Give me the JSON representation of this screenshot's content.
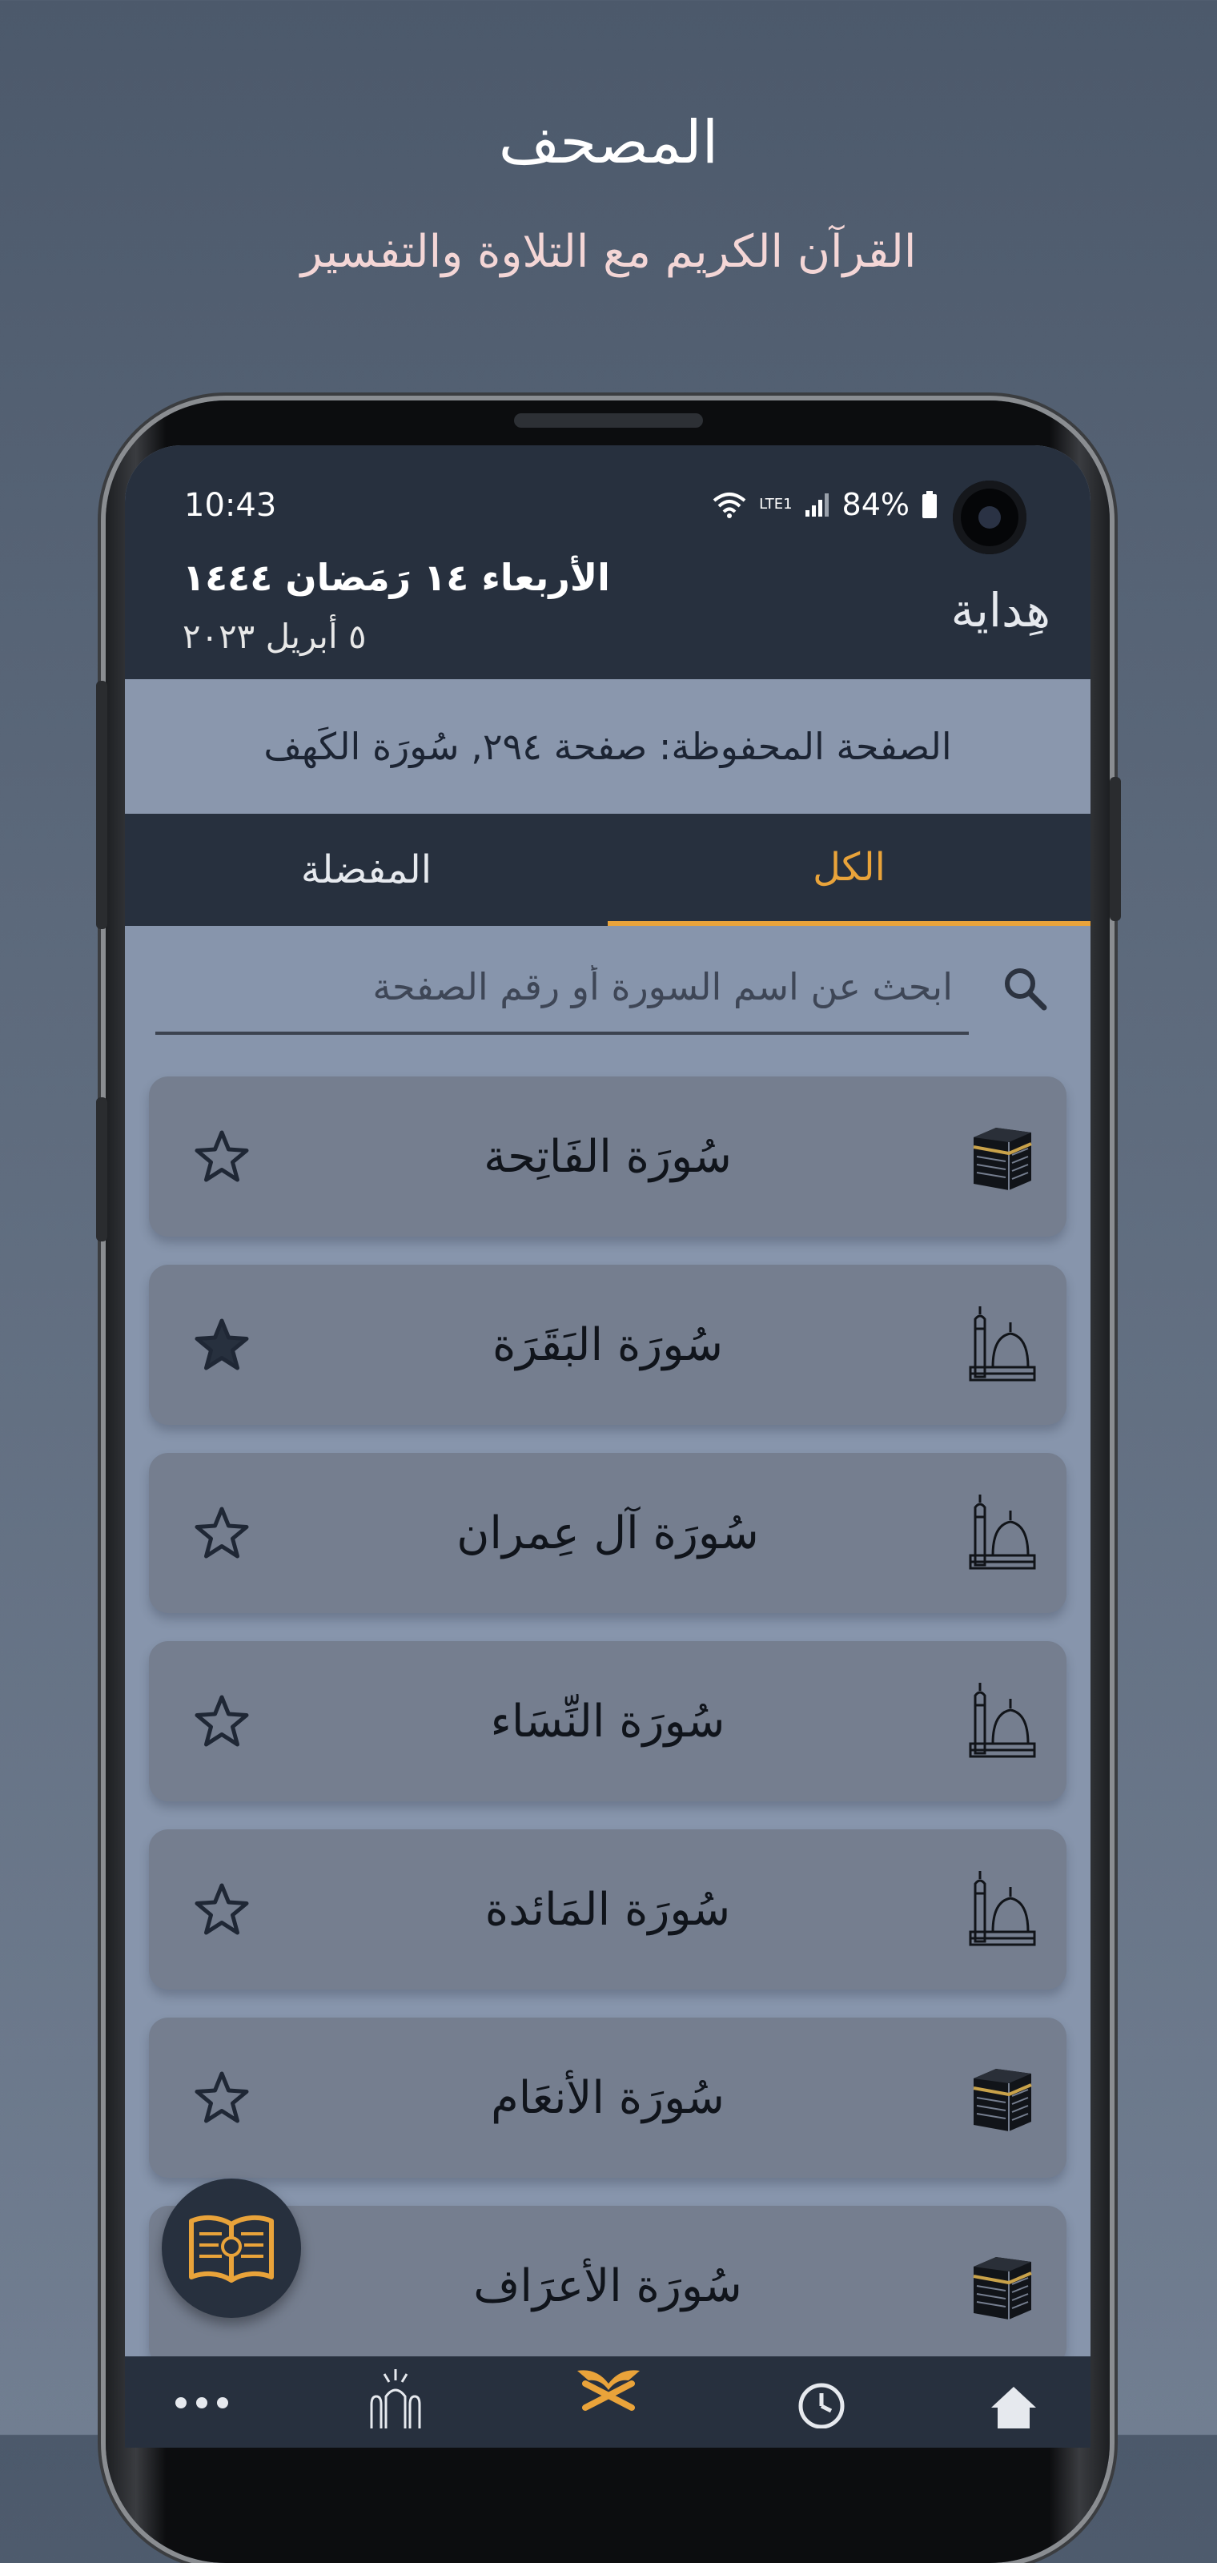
{
  "promo": {
    "title": "المصحف",
    "subtitle": "القرآن الكريم مع التلاوة والتفسير"
  },
  "status_bar": {
    "time": "10:43",
    "battery": "84%",
    "network_label": "LTE1"
  },
  "header": {
    "hijri_date": "الأربعاء ١٤ رَمَضان ١٤٤٤",
    "gregorian_date": "٥ أبريل ٢٠٢٣",
    "app_name": "هِداية"
  },
  "saved_page": {
    "text": "الصفحة المحفوظة: صفحة ٢٩٤, سُورَة الكَهف"
  },
  "tabs": {
    "all": "الكل",
    "favorites": "المفضلة"
  },
  "search": {
    "placeholder": "ابحث عن اسم السورة أو رقم الصفحة"
  },
  "surahs": [
    {
      "name": "سُورَة الفَاتِحة",
      "revelation": "makki",
      "icon": "kaaba-icon",
      "favorite": false
    },
    {
      "name": "سُورَة البَقَرَة",
      "revelation": "madani",
      "icon": "mosque-icon",
      "favorite": true
    },
    {
      "name": "سُورَة آل عِمران",
      "revelation": "madani",
      "icon": "mosque-icon",
      "favorite": false
    },
    {
      "name": "سُورَة النِّسَاء",
      "revelation": "madani",
      "icon": "mosque-icon",
      "favorite": false
    },
    {
      "name": "سُورَة المَائدة",
      "revelation": "madani",
      "icon": "mosque-icon",
      "favorite": false
    },
    {
      "name": "سُورَة الأنعَام",
      "revelation": "makki",
      "icon": "kaaba-icon",
      "favorite": false
    },
    {
      "name": "سُورَة الأعرَاف",
      "revelation": "makki",
      "icon": "kaaba-icon",
      "favorite": false
    }
  ],
  "colors": {
    "accent": "#e9a33a",
    "header_bg": "#27303e",
    "screen_bg": "#8795ac",
    "row_bg": "#757e8f",
    "star_fill": "#27303e"
  },
  "fab": {
    "icon": "open-book-icon"
  },
  "bottom_nav": [
    {
      "icon": "more-dots-icon"
    },
    {
      "icon": "mosque-domes-icon"
    },
    {
      "icon": "quran-stand-icon",
      "active": true
    },
    {
      "icon": "clock-icon"
    },
    {
      "icon": "home-icon"
    }
  ]
}
